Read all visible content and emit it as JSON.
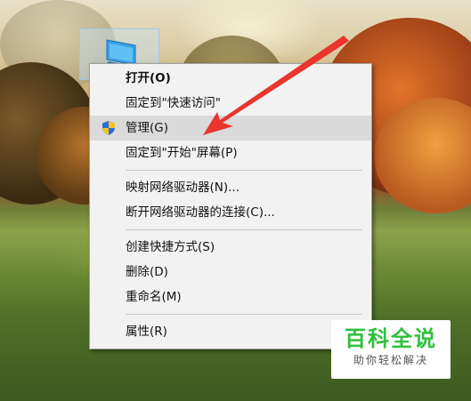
{
  "desktop": {
    "icon": {
      "name": "monitor-icon"
    }
  },
  "context_menu": {
    "groups": [
      [
        {
          "label": "打开(O)",
          "bold": true
        },
        {
          "label": "固定到\"快速访问\""
        },
        {
          "label": "管理(G)",
          "icon": "uac-shield-icon",
          "highlighted": true
        },
        {
          "label": "固定到\"开始\"屏幕(P)"
        }
      ],
      [
        {
          "label": "映射网络驱动器(N)..."
        },
        {
          "label": "断开网络驱动器的连接(C)..."
        }
      ],
      [
        {
          "label": "创建快捷方式(S)"
        },
        {
          "label": "删除(D)"
        },
        {
          "label": "重命名(M)"
        }
      ],
      [
        {
          "label": "属性(R)"
        }
      ]
    ]
  },
  "annotation": {
    "color": "#e8352e"
  },
  "watermark": {
    "title": "百科全说",
    "subtitle": "助你轻松解决",
    "title_color": "#2fbf3a"
  }
}
